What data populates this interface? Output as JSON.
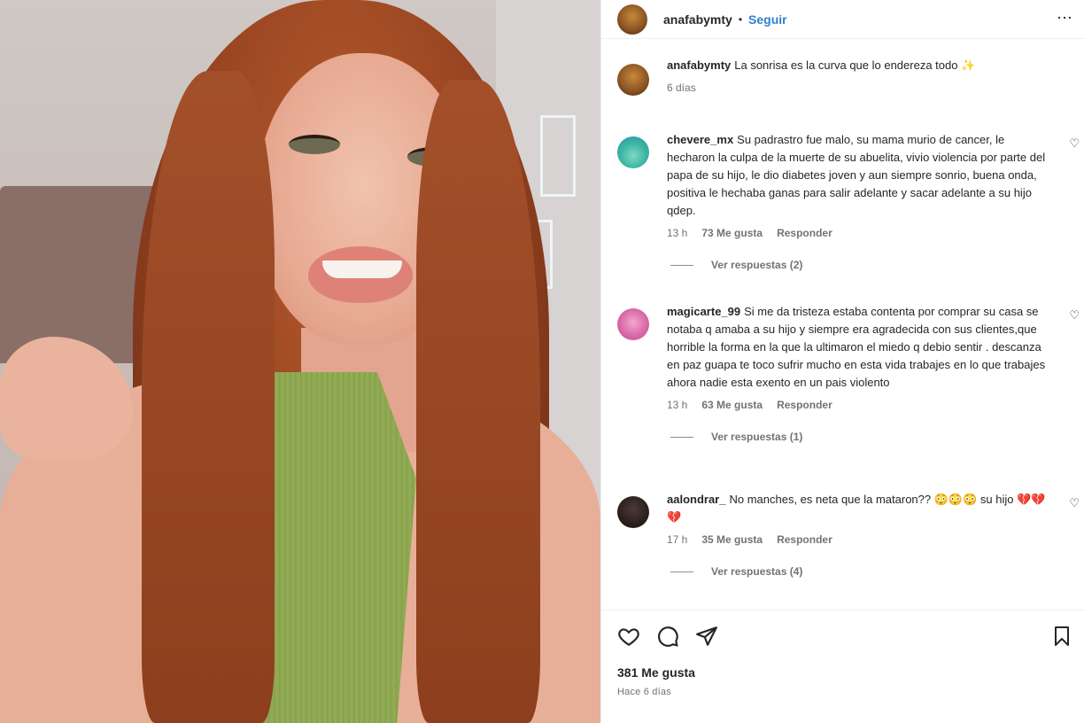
{
  "header": {
    "username": "anafabymty",
    "separator": "•",
    "follow_label": "Seguir",
    "more_icon": "⋯"
  },
  "caption": {
    "username": "anafabymty",
    "text": "La sonrisa es la curva que lo endereza todo ✨",
    "time": "6 días"
  },
  "comments": [
    {
      "username": "chevere_mx",
      "text": "Su padrastro fue malo, su mama murio de cancer, le hecharon la culpa de la muerte de su abuelita, vivio violencia por parte del papa de su hijo, le dio diabetes joven y aun siempre sonrio, buena onda, positiva le hechaba ganas para salir adelante y sacar adelante a su hijo qdep.",
      "time": "13 h",
      "likes": "73 Me gusta",
      "reply": "Responder",
      "view_replies": "Ver respuestas (2)"
    },
    {
      "username": "magicarte_99",
      "text": "Si me da tristeza estaba contenta por comprar su casa se notaba q amaba a su hijo y siempre era agradecida con sus clientes,que horrible la forma en la que la ultimaron el miedo q debio sentir . descanza en paz guapa te toco sufrir mucho en esta vida trabajes en lo que trabajes ahora nadie esta exento en un pais violento",
      "time": "13 h",
      "likes": "63 Me gusta",
      "reply": "Responder",
      "view_replies": "Ver respuestas (1)"
    },
    {
      "username": "aalondrar_",
      "text": "No manches, es neta que la mataron?? 😳😳😳 su hijo 💔💔💔",
      "time": "17 h",
      "likes": "35 Me gusta",
      "reply": "Responder",
      "view_replies": "Ver respuestas (4)"
    }
  ],
  "footer": {
    "like_count": "381 Me gusta",
    "time_ago": "Hace 6 días"
  },
  "icons": {
    "like": "heart-icon",
    "comment": "comment-icon",
    "share": "share-icon",
    "save": "bookmark-icon",
    "comment_like": "♡"
  },
  "colors": {
    "follow": "#2f7fd2",
    "secondary_text": "#737373",
    "primary_text": "#262626"
  }
}
